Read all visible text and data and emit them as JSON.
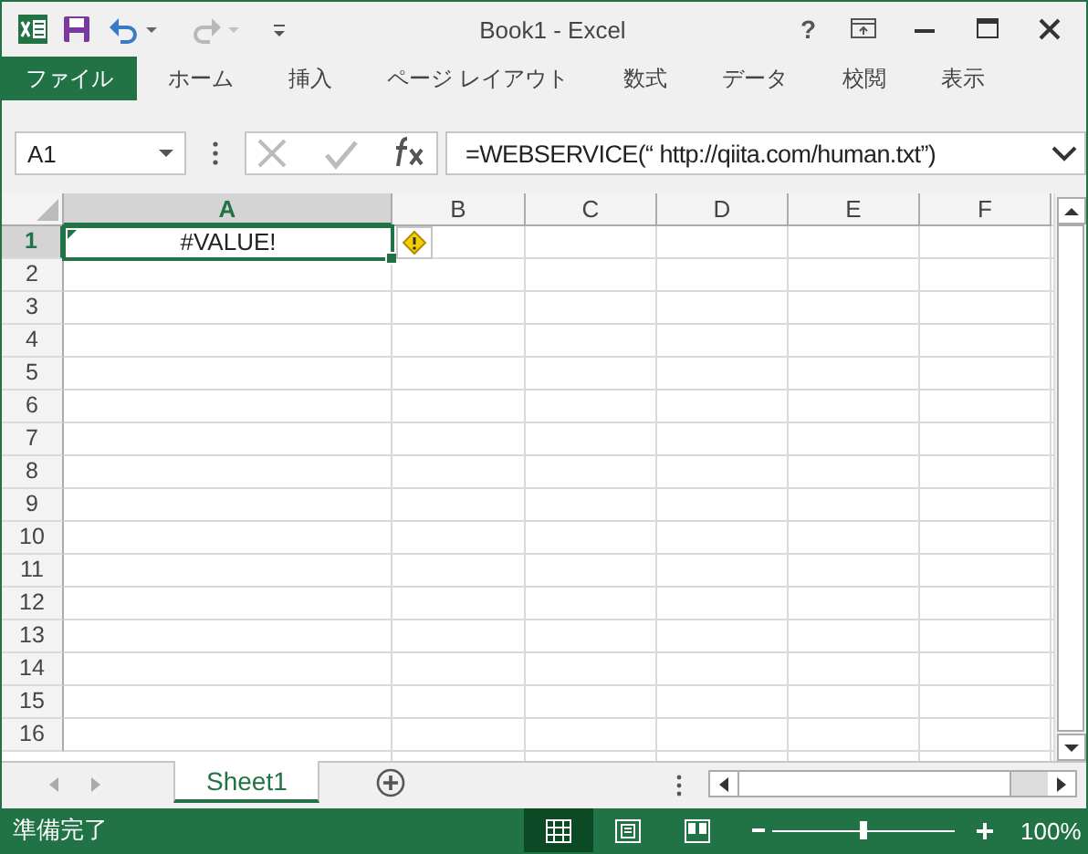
{
  "window": {
    "title": "Book1 - Excel",
    "help": "?"
  },
  "quick_access": [
    {
      "kind": "save",
      "disabled": false
    },
    {
      "kind": "undo",
      "disabled": false
    },
    {
      "kind": "redo",
      "disabled": true
    },
    {
      "kind": "customize",
      "disabled": false
    }
  ],
  "ribbon_tabs": [
    {
      "label": "ファイル",
      "kind": "file",
      "selected": false
    },
    {
      "label": "ホーム",
      "kind": "tab",
      "selected": false
    },
    {
      "label": "挿入",
      "kind": "tab",
      "selected": false
    },
    {
      "label": "ページ レイアウト",
      "kind": "tab",
      "selected": false
    },
    {
      "label": "数式",
      "kind": "tab",
      "selected": false
    },
    {
      "label": "データ",
      "kind": "tab",
      "selected": false
    },
    {
      "label": "校閲",
      "kind": "tab",
      "selected": false
    },
    {
      "label": "表示",
      "kind": "tab",
      "selected": false
    }
  ],
  "formula_bar": {
    "name_box": "A1",
    "formula": "=WEBSERVICE(“ http://qiita.com/human.txt”)"
  },
  "columns": [
    {
      "label": "A",
      "selected": true
    },
    {
      "label": "B",
      "selected": false
    },
    {
      "label": "C",
      "selected": false
    },
    {
      "label": "D",
      "selected": false
    },
    {
      "label": "E",
      "selected": false
    },
    {
      "label": "F",
      "selected": false
    }
  ],
  "rows": [
    {
      "label": "1",
      "selected": true,
      "cells": [
        {
          "value": "#VALUE!",
          "selected": true,
          "error": true
        }
      ]
    },
    {
      "label": "2",
      "selected": false
    },
    {
      "label": "3",
      "selected": false
    },
    {
      "label": "4",
      "selected": false
    },
    {
      "label": "5",
      "selected": false
    },
    {
      "label": "6",
      "selected": false
    },
    {
      "label": "7",
      "selected": false
    },
    {
      "label": "8",
      "selected": false
    },
    {
      "label": "9",
      "selected": false
    },
    {
      "label": "10",
      "selected": false
    },
    {
      "label": "11",
      "selected": false
    },
    {
      "label": "12",
      "selected": false
    },
    {
      "label": "13",
      "selected": false
    },
    {
      "label": "14",
      "selected": false
    },
    {
      "label": "15",
      "selected": false
    },
    {
      "label": "16",
      "selected": false
    }
  ],
  "sheet_tabs": [
    {
      "label": "Sheet1",
      "selected": true
    }
  ],
  "status_bar": {
    "status": "準備完了",
    "views": [
      {
        "kind": "normal",
        "selected": true
      },
      {
        "kind": "page_layout",
        "selected": false
      },
      {
        "kind": "page_break",
        "selected": false
      }
    ],
    "zoom": {
      "level": 0.5,
      "reading": "100%"
    }
  }
}
